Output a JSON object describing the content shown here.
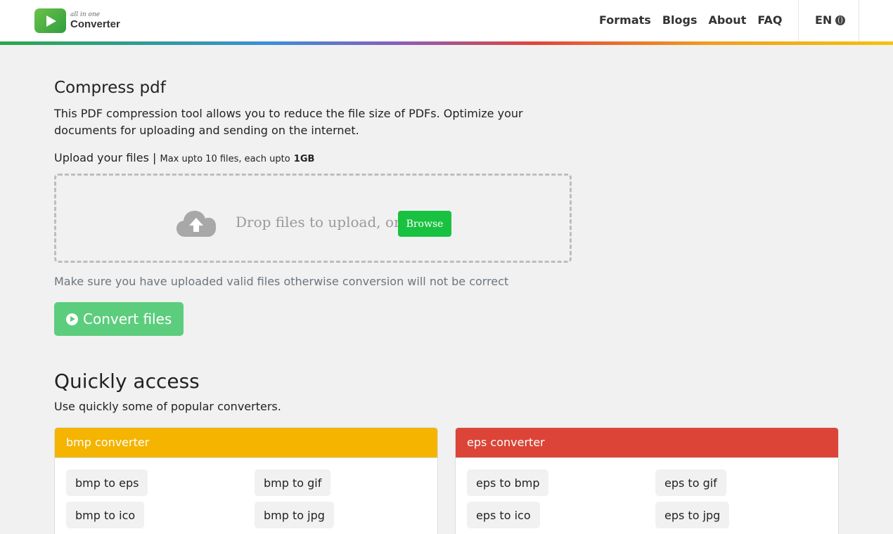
{
  "brand": {
    "small": "all in one",
    "big": "Converter"
  },
  "nav": {
    "links": [
      "Formats",
      "Blogs",
      "About",
      "FAQ"
    ],
    "lang": "EN"
  },
  "main": {
    "title": "Compress pdf",
    "description": "This PDF compression tool allows you to reduce the file size of PDFs. Optimize your documents for uploading and sending on the internet.",
    "upload_label": "Upload your files |",
    "upload_limit": "Max upto 10 files, each upto",
    "upload_size": "1GB",
    "drop_text": "Drop files to upload, or",
    "browse": "Browse",
    "warning": "Make sure you have uploaded valid files otherwise conversion will not be correct",
    "convert": "Convert files"
  },
  "quick": {
    "title": "Quickly access",
    "subtitle": "Use quickly some of popular converters.",
    "cards": [
      {
        "title": "bmp converter",
        "color": "#f4b400",
        "links": [
          "bmp to eps",
          "bmp to gif",
          "bmp to ico",
          "bmp to jpg"
        ]
      },
      {
        "title": "eps converter",
        "color": "#db4437",
        "links": [
          "eps to bmp",
          "eps to gif",
          "eps to ico",
          "eps to jpg"
        ]
      }
    ]
  }
}
